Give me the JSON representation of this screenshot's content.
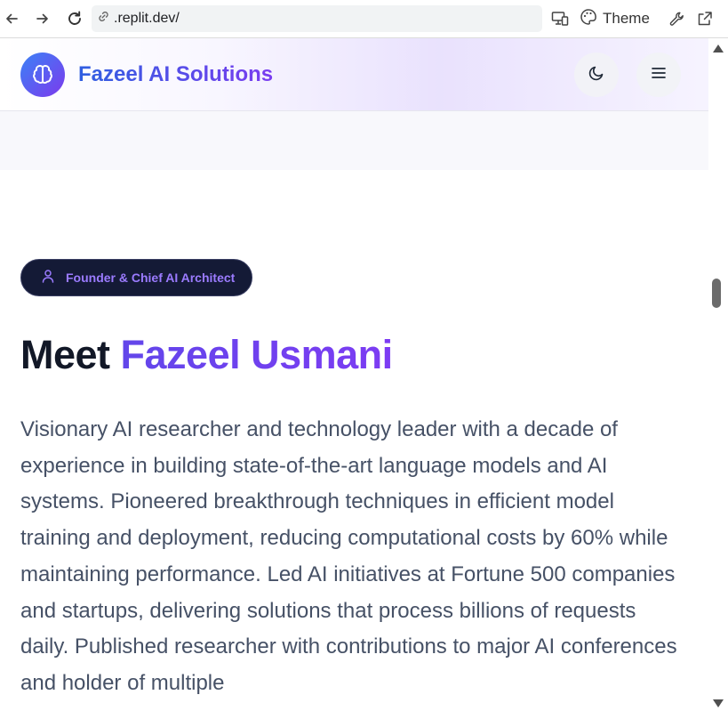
{
  "browser": {
    "url": ".replit.dev/",
    "theme_label": "Theme",
    "icons": [
      "back-arrow-icon",
      "forward-arrow-icon",
      "reload-icon",
      "link-icon",
      "devices-icon",
      "palette-icon",
      "wrench-icon",
      "external-link-icon"
    ]
  },
  "header": {
    "brand": "Fazeel AI Solutions",
    "logo_icon": "brain-icon",
    "dark_mode_icon": "moon-icon",
    "menu_icon": "hamburger-menu-icon"
  },
  "hero": {
    "badge_label": "Founder & Chief AI Architect",
    "badge_icon": "user-icon",
    "heading_prefix": "Meet ",
    "heading_name": "Fazeel Usmani",
    "bio": "Visionary AI researcher and technology leader with a decade of experience in building state-of-the-art language models and AI systems. Pioneered breakthrough techniques in efficient model training and deployment, reducing computational costs by 60% while maintaining performance. Led AI initiatives at Fortune 500 companies and startups, delivering solutions that process billions of requests daily. Published researcher with contributions to major AI conferences and holder of multiple"
  },
  "colors": {
    "brand_gradient_start": "#2f5fe0",
    "brand_gradient_end": "#7a3cf0",
    "accent_purple": "#6246ea",
    "badge_background": "#141a36",
    "body_text": "#465166",
    "heading_text": "#121827"
  }
}
